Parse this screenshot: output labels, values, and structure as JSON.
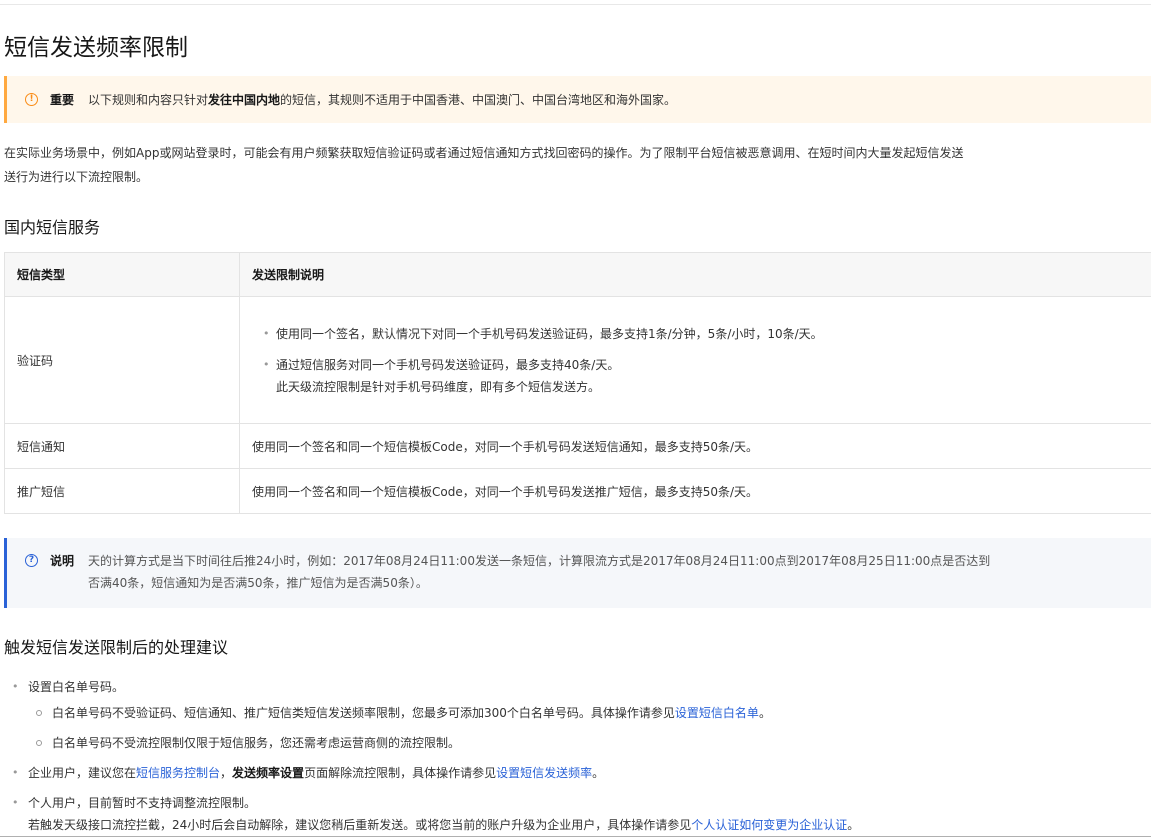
{
  "page": {
    "title": "短信发送频率限制"
  },
  "important_notice": {
    "label": "重要",
    "text_before": "以下规则和内容只针对",
    "text_strong": "发往中国内地",
    "text_after": "的短信，其规则不适用于中国香港、中国澳门、中国台湾地区和海外国家。"
  },
  "intro": {
    "line1": "在实际业务场景中，例如App或网站登录时，可能会有用户频繁获取短信验证码或者通过短信通知方式找回密码的操作。为了限制平台短信被恶意调用、在短时间内大量发起短信发送",
    "line2": "送行为进行以下流控限制。"
  },
  "domestic_section": {
    "heading": "国内短信服务",
    "columns": [
      "短信类型",
      "发送限制说明"
    ],
    "rows": [
      {
        "type": "验证码",
        "items": [
          "使用同一个签名，默认情况下对同一个手机号码发送验证码，最多支持1条/分钟，5条/小时，10条/天。",
          "通过短信服务对同一个手机号码发送验证码，最多支持40条/天。"
        ],
        "item_extra": "此天级流控限制是针对手机号码维度，即有多个短信发送方。"
      },
      {
        "type": "短信通知",
        "text": "使用同一个签名和同一个短信模板Code，对同一个手机号码发送短信通知，最多支持50条/天。"
      },
      {
        "type": "推广短信",
        "text": "使用同一个签名和同一个短信模板Code，对同一个手机号码发送推广短信，最多支持50条/天。"
      }
    ]
  },
  "note_notice": {
    "label": "说明",
    "line1": "天的计算方式是当下时间往后推24小时，例如：2017年08月24日11:00发送一条短信，计算限流方式是2017年08月24日11:00点到2017年08月25日11:00点是否达到",
    "line2": "否满40条，短信通知为是否满50条，推广短信为是否满50条）。"
  },
  "suggest_section": {
    "heading": "触发短信发送限制后的处理建议",
    "item1": {
      "text": "设置白名单号码。",
      "sub1_text": "白名单号码不受验证码、短信通知、推广短信类短信发送频率限制，您最多可添加300个白名单号码。具体操作请参见",
      "sub1_link": "设置短信白名单",
      "sub1_end": "。",
      "sub2_text": "白名单号码不受流控限制仅限于短信服务，您还需考虑运营商侧的流控限制。"
    },
    "item2": {
      "text_before": "企业用户，建议您在",
      "link1": "短信服务控制台",
      "text_mid1": "，",
      "strong": "发送频率设置",
      "text_mid2": "页面解除流控限制，具体操作请参见",
      "link2": "设置短信发送频率",
      "text_end": "。"
    },
    "item3": {
      "text": "个人用户，目前暂时不支持调整流控限制。",
      "line2_before": "若触发天级接口流控拦截，24小时后会自动解除，建议您稍后重新发送。或将您当前的账户升级为企业用户，具体操作请参见",
      "line2_link": "个人认证如何变更为企业认证",
      "line2_end": "。"
    }
  },
  "colors": {
    "link": "#2a62d7",
    "warning_accent": "#ffa940",
    "note_accent": "#2a62d7"
  },
  "icons": {
    "important": "exclamation-circle-icon",
    "note": "question-circle-icon"
  }
}
